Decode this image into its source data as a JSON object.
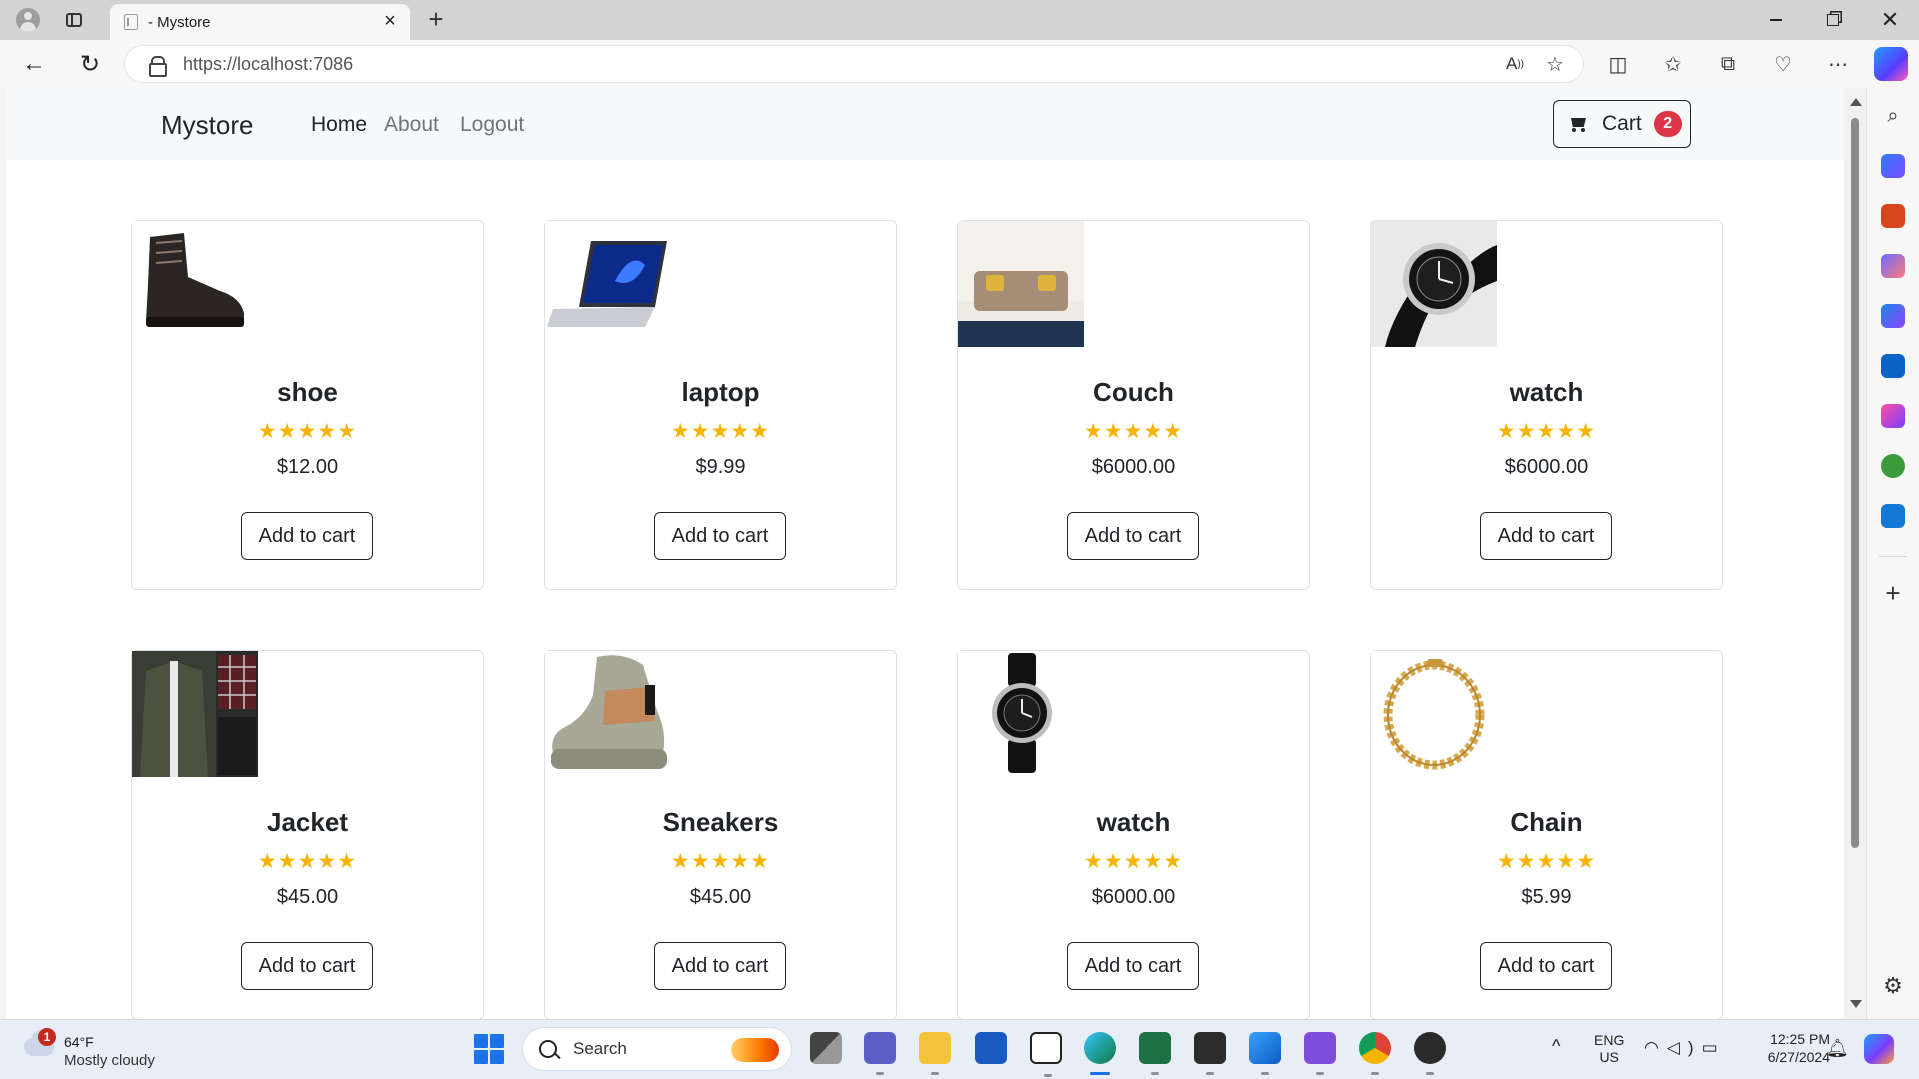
{
  "browser": {
    "tab_title": "- Mystore",
    "url": "https://localhost:7086",
    "icons": [
      "profile-icon",
      "tab-actions-icon",
      "favicon-icon",
      "close-icon",
      "plus-icon",
      "minimize-icon",
      "restore-icon",
      "close-window-icon",
      "back-icon",
      "reload-icon",
      "lock-icon",
      "read-aloud-icon",
      "favorite-star-icon",
      "split-screen-icon",
      "favorites-icon",
      "collections-icon",
      "browser-essentials-icon",
      "more-icon",
      "copilot-icon"
    ],
    "sidebar_icons": [
      "search-icon",
      "shopping-icon",
      "tools-icon",
      "games-icon",
      "microsoft-365-icon",
      "outlook-icon",
      "designer-icon",
      "tree-icon",
      "send-icon",
      "add-icon",
      "settings-icon"
    ]
  },
  "site": {
    "brand": "Mystore",
    "nav": [
      "Home",
      "About",
      "Logout"
    ],
    "cart_label": "Cart",
    "cart_count": "2"
  },
  "products": [
    {
      "name": "shoe",
      "price": "$12.00",
      "rating": 5,
      "button": "Add to cart"
    },
    {
      "name": "laptop",
      "price": "$9.99",
      "rating": 5,
      "button": "Add to cart"
    },
    {
      "name": "Couch",
      "price": "$6000.00",
      "rating": 5,
      "button": "Add to cart"
    },
    {
      "name": "watch",
      "price": "$6000.00",
      "rating": 5,
      "button": "Add to cart"
    },
    {
      "name": "Jacket",
      "price": "$45.00",
      "rating": 5,
      "button": "Add to cart"
    },
    {
      "name": "Sneakers",
      "price": "$45.00",
      "rating": 5,
      "button": "Add to cart"
    },
    {
      "name": "watch",
      "price": "$6000.00",
      "rating": 5,
      "button": "Add to cart"
    },
    {
      "name": "Chain",
      "price": "$5.99",
      "rating": 5,
      "button": "Add to cart"
    }
  ],
  "taskbar": {
    "weather_alert_count": "1",
    "temperature": "64°F",
    "weather_desc": "Mostly cloudy",
    "search_placeholder": "Search",
    "language": "ENG",
    "region": "US",
    "time": "12:25 PM",
    "date": "6/27/2024",
    "apps": [
      "windows-start-icon",
      "task-view-icon",
      "teams-icon",
      "file-explorer-icon",
      "word-icon",
      "paint-icon",
      "edge-icon",
      "excel-icon",
      "terminal-icon",
      "photos-icon",
      "visual-studio-icon",
      "chrome-icon",
      "media-player-icon"
    ]
  },
  "colors": {
    "accent_badge": "#dc3545",
    "star": "#f5b400",
    "navbar_bg": "#f8f9fa",
    "taskbar_bg": "#e8eef7"
  }
}
